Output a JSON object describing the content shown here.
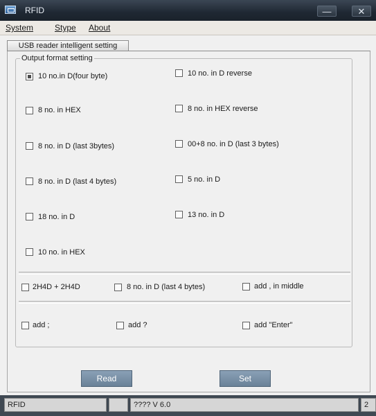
{
  "window": {
    "title": "RFID",
    "minimize_glyph": "—",
    "close_glyph": "✕"
  },
  "menu": {
    "items": [
      "System",
      "Stype",
      "About"
    ]
  },
  "tab": {
    "label": "USB reader intelligent setting"
  },
  "group": {
    "legend": "Output format setting"
  },
  "options": {
    "left": [
      {
        "label": "10 no.in D(four byte)",
        "checked": true
      },
      {
        "label": "8 no. in HEX",
        "checked": false
      },
      {
        "label": " 8 no. in D (last 3bytes)",
        "checked": false
      },
      {
        "label": "8 no. in D (last 4 bytes)",
        "checked": false
      },
      {
        "label": "18 no. in D",
        "checked": false
      },
      {
        "label": "10 no. in HEX",
        "checked": false
      }
    ],
    "right": [
      {
        "label": "10 no. in D reverse",
        "checked": false
      },
      {
        "label": "8 no. in HEX reverse",
        "checked": false
      },
      {
        "label": " 00+8 no. in D (last 3 bytes)",
        "checked": false
      },
      {
        "label": "5 no. in D",
        "checked": false
      },
      {
        "label": "13 no. in D",
        "checked": false
      }
    ],
    "row2": [
      {
        "label": "2H4D + 2H4D",
        "checked": false
      },
      {
        "label": "8 no. in D (last 4 bytes)",
        "checked": false
      },
      {
        "label": "add , in middle",
        "checked": false
      }
    ],
    "row3": [
      {
        "label": "add ;",
        "checked": false
      },
      {
        "label": "add ?",
        "checked": false
      },
      {
        "label": "add \"Enter\"",
        "checked": false
      }
    ]
  },
  "buttons": {
    "read": "Read",
    "set": "Set"
  },
  "status": {
    "cell1": "RFID",
    "cell2": "",
    "cell3": "????  V 6.0",
    "cell4": "2"
  }
}
